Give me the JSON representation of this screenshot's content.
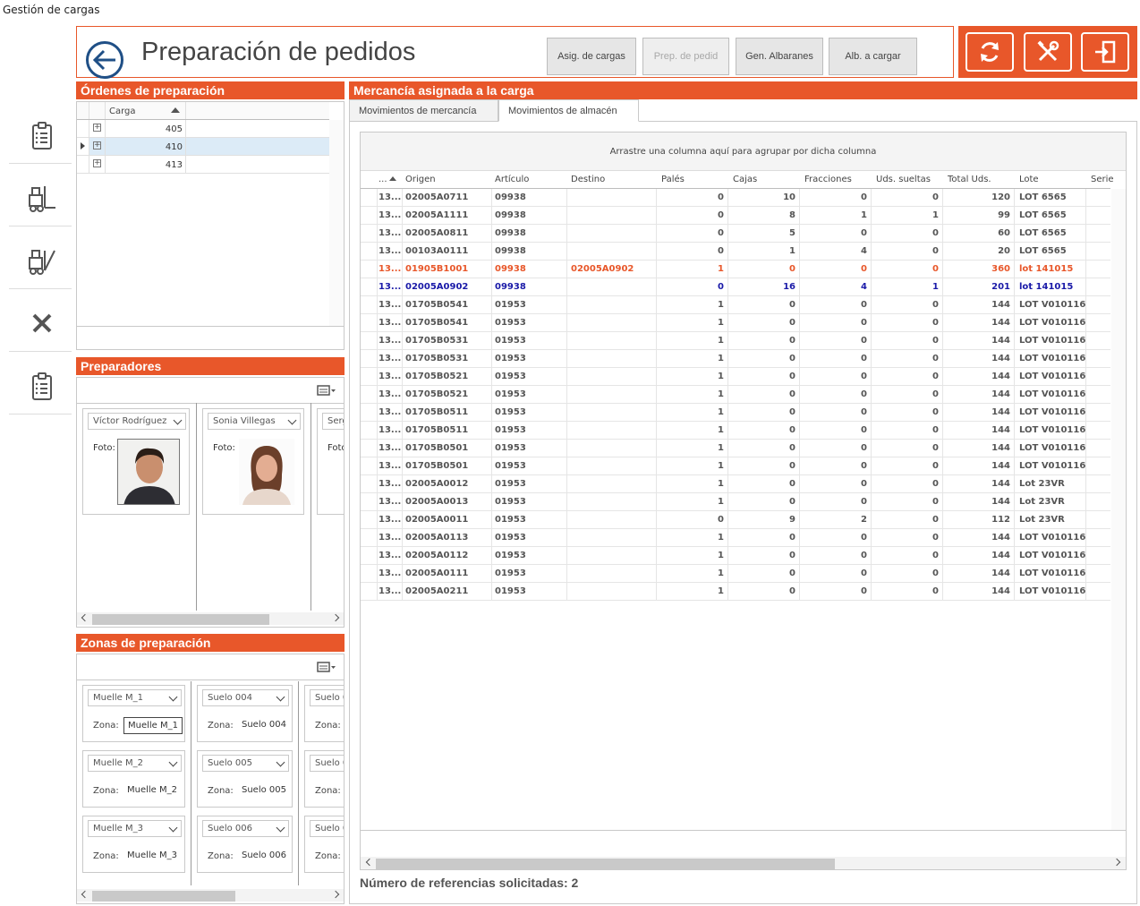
{
  "window_title": "Gestión de cargas",
  "header": {
    "title": "Preparación de pedidos",
    "buttons": [
      "Asig. de cargas",
      "Prep. de pedid",
      "Gen. Albaranes",
      "Alb. a cargar"
    ]
  },
  "colors": {
    "accent": "#e8572a",
    "highlight_orange": "#e8572a",
    "highlight_blue": "#1a1aa8",
    "selected_row": "#dcebf7"
  },
  "rail_icons": [
    "clipboard-list-icon",
    "forklift-icon",
    "forklift-unload-icon",
    "close-x-icon",
    "clipboard-list-icon"
  ],
  "toolbar_icons": [
    "refresh-icon",
    "tools-icon",
    "exit-door-icon"
  ],
  "ordenes": {
    "title": "Órdenes de preparación",
    "column": "Carga",
    "rows": [
      "405",
      "410",
      "413"
    ],
    "selected_index": 1
  },
  "preparadores": {
    "title": "Preparadores",
    "foto_label": "Foto:",
    "people": [
      "Víctor Rodríguez",
      "Sonia Villegas",
      "Serg"
    ]
  },
  "zonas": {
    "title": "Zonas de preparación",
    "zona_label": "Zona:",
    "columns": [
      [
        {
          "name": "Muelle M_1",
          "zona": "Muelle M_1"
        },
        {
          "name": "Muelle M_2",
          "zona": "Muelle M_2"
        },
        {
          "name": "Muelle M_3",
          "zona": "Muelle M_3"
        }
      ],
      [
        {
          "name": "Suelo 004",
          "zona": "Suelo 004"
        },
        {
          "name": "Suelo 005",
          "zona": "Suelo 005"
        },
        {
          "name": "Suelo 006",
          "zona": "Suelo 006"
        }
      ],
      [
        {
          "name": "Suelo 0",
          "zona": ""
        },
        {
          "name": "Suelo 0",
          "zona": ""
        },
        {
          "name": "Suelo 0",
          "zona": ""
        }
      ]
    ]
  },
  "mercancia": {
    "title": "Mercancía asignada a la carga",
    "tabs": [
      "Movimientos de mercancía",
      "Movimientos de almacén"
    ],
    "active_tab": 1,
    "group_hint": "Arrastre una columna aquí para agrupar por dicha columna",
    "columns": [
      "...",
      "Origen",
      "Artículo",
      "Destino",
      "Palés",
      "Cajas",
      "Fracciones",
      "Uds. sueltas",
      "Total Uds.",
      "Lote",
      "Serie"
    ],
    "rows": [
      {
        "id": "13...",
        "origen": "02005A0711",
        "articulo": "09938",
        "destino": "",
        "pales": "0",
        "cajas": "10",
        "fracciones": "0",
        "sueltas": "0",
        "total": "120",
        "lote": "LOT 6565",
        "style": "normal"
      },
      {
        "id": "13...",
        "origen": "02005A1111",
        "articulo": "09938",
        "destino": "",
        "pales": "0",
        "cajas": "8",
        "fracciones": "1",
        "sueltas": "1",
        "total": "99",
        "lote": "LOT 6565",
        "style": "normal"
      },
      {
        "id": "13...",
        "origen": "02005A0811",
        "articulo": "09938",
        "destino": "",
        "pales": "0",
        "cajas": "5",
        "fracciones": "0",
        "sueltas": "0",
        "total": "60",
        "lote": "LOT 6565",
        "style": "normal"
      },
      {
        "id": "13...",
        "origen": "00103A0111",
        "articulo": "09938",
        "destino": "",
        "pales": "0",
        "cajas": "1",
        "fracciones": "4",
        "sueltas": "0",
        "total": "20",
        "lote": "LOT 6565",
        "style": "normal"
      },
      {
        "id": "13...",
        "origen": "01905B1001",
        "articulo": "09938",
        "destino": "02005A0902",
        "pales": "1",
        "cajas": "0",
        "fracciones": "0",
        "sueltas": "0",
        "total": "360",
        "lote": "lot 141015",
        "style": "orange"
      },
      {
        "id": "13...",
        "origen": "02005A0902",
        "articulo": "09938",
        "destino": "",
        "pales": "0",
        "cajas": "16",
        "fracciones": "4",
        "sueltas": "1",
        "total": "201",
        "lote": "lot 141015",
        "style": "blue"
      },
      {
        "id": "13...",
        "origen": "01705B0541",
        "articulo": "01953",
        "destino": "",
        "pales": "1",
        "cajas": "0",
        "fracciones": "0",
        "sueltas": "0",
        "total": "144",
        "lote": "LOT V010116",
        "style": "normal"
      },
      {
        "id": "13...",
        "origen": "01705B0541",
        "articulo": "01953",
        "destino": "",
        "pales": "1",
        "cajas": "0",
        "fracciones": "0",
        "sueltas": "0",
        "total": "144",
        "lote": "LOT V010116",
        "style": "normal"
      },
      {
        "id": "13...",
        "origen": "01705B0531",
        "articulo": "01953",
        "destino": "",
        "pales": "1",
        "cajas": "0",
        "fracciones": "0",
        "sueltas": "0",
        "total": "144",
        "lote": "LOT V010116",
        "style": "normal"
      },
      {
        "id": "13...",
        "origen": "01705B0531",
        "articulo": "01953",
        "destino": "",
        "pales": "1",
        "cajas": "0",
        "fracciones": "0",
        "sueltas": "0",
        "total": "144",
        "lote": "LOT V010116",
        "style": "normal"
      },
      {
        "id": "13...",
        "origen": "01705B0521",
        "articulo": "01953",
        "destino": "",
        "pales": "1",
        "cajas": "0",
        "fracciones": "0",
        "sueltas": "0",
        "total": "144",
        "lote": "LOT V010116",
        "style": "normal"
      },
      {
        "id": "13...",
        "origen": "01705B0521",
        "articulo": "01953",
        "destino": "",
        "pales": "1",
        "cajas": "0",
        "fracciones": "0",
        "sueltas": "0",
        "total": "144",
        "lote": "LOT V010116",
        "style": "normal"
      },
      {
        "id": "13...",
        "origen": "01705B0511",
        "articulo": "01953",
        "destino": "",
        "pales": "1",
        "cajas": "0",
        "fracciones": "0",
        "sueltas": "0",
        "total": "144",
        "lote": "LOT V010116",
        "style": "normal"
      },
      {
        "id": "13...",
        "origen": "01705B0511",
        "articulo": "01953",
        "destino": "",
        "pales": "1",
        "cajas": "0",
        "fracciones": "0",
        "sueltas": "0",
        "total": "144",
        "lote": "LOT V010116",
        "style": "normal"
      },
      {
        "id": "13...",
        "origen": "01705B0501",
        "articulo": "01953",
        "destino": "",
        "pales": "1",
        "cajas": "0",
        "fracciones": "0",
        "sueltas": "0",
        "total": "144",
        "lote": "LOT V010116",
        "style": "normal"
      },
      {
        "id": "13...",
        "origen": "01705B0501",
        "articulo": "01953",
        "destino": "",
        "pales": "1",
        "cajas": "0",
        "fracciones": "0",
        "sueltas": "0",
        "total": "144",
        "lote": "LOT V010116",
        "style": "normal"
      },
      {
        "id": "13...",
        "origen": "02005A0012",
        "articulo": "01953",
        "destino": "",
        "pales": "1",
        "cajas": "0",
        "fracciones": "0",
        "sueltas": "0",
        "total": "144",
        "lote": "Lot 23VR",
        "style": "normal"
      },
      {
        "id": "13...",
        "origen": "02005A0013",
        "articulo": "01953",
        "destino": "",
        "pales": "1",
        "cajas": "0",
        "fracciones": "0",
        "sueltas": "0",
        "total": "144",
        "lote": "Lot 23VR",
        "style": "normal"
      },
      {
        "id": "13...",
        "origen": "02005A0011",
        "articulo": "01953",
        "destino": "",
        "pales": "0",
        "cajas": "9",
        "fracciones": "2",
        "sueltas": "0",
        "total": "112",
        "lote": "Lot 23VR",
        "style": "normal"
      },
      {
        "id": "13...",
        "origen": "02005A0113",
        "articulo": "01953",
        "destino": "",
        "pales": "1",
        "cajas": "0",
        "fracciones": "0",
        "sueltas": "0",
        "total": "144",
        "lote": "LOT V010116",
        "style": "normal"
      },
      {
        "id": "13...",
        "origen": "02005A0112",
        "articulo": "01953",
        "destino": "",
        "pales": "1",
        "cajas": "0",
        "fracciones": "0",
        "sueltas": "0",
        "total": "144",
        "lote": "LOT V010116",
        "style": "normal"
      },
      {
        "id": "13...",
        "origen": "02005A0111",
        "articulo": "01953",
        "destino": "",
        "pales": "1",
        "cajas": "0",
        "fracciones": "0",
        "sueltas": "0",
        "total": "144",
        "lote": "LOT V010116",
        "style": "normal"
      },
      {
        "id": "13...",
        "origen": "02005A0211",
        "articulo": "01953",
        "destino": "",
        "pales": "1",
        "cajas": "0",
        "fracciones": "0",
        "sueltas": "0",
        "total": "144",
        "lote": "LOT V010116",
        "style": "normal"
      }
    ],
    "footer": "Número de referencias solicitadas: 2"
  }
}
